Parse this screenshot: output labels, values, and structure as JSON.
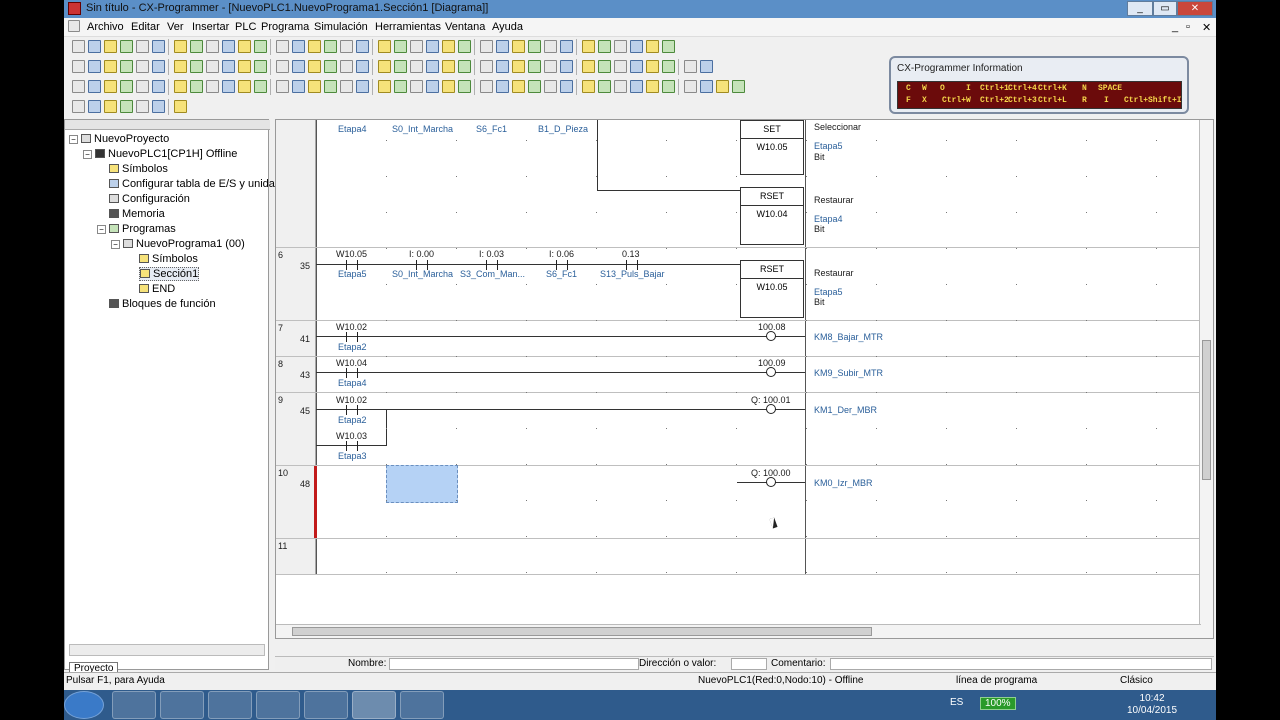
{
  "window": {
    "title": "Sin título - CX-Programmer - [NuevoPLC1.NuevoPrograma1.Sección1 [Diagrama]]"
  },
  "menu": [
    "Archivo",
    "Editar",
    "Ver",
    "Insertar",
    "PLC",
    "Programa",
    "Simulación",
    "Herramientas",
    "Ventana",
    "Ayuda"
  ],
  "info_panel": {
    "title": "CX-Programmer Information",
    "keys_top": [
      "C",
      "W",
      "O",
      "I",
      "Ctrl+1",
      "Ctrl+4",
      "Ctrl+K",
      "N",
      "SPACE"
    ],
    "keys_bottom": [
      "F",
      "X",
      "Ctrl+W",
      "Ctrl+2",
      "Ctrl+3",
      "Ctrl+L",
      "R",
      "I",
      "Ctrl+Shift+I"
    ]
  },
  "project_tree": {
    "root": "NuevoProyecto",
    "plc": "NuevoPLC1[CP1H] Offline",
    "items": [
      "Símbolos",
      "Configurar tabla de E/S y unida",
      "Configuración",
      "Memoria",
      "Programas"
    ],
    "program": "NuevoPrograma1 (00)",
    "program_items": [
      "Símbolos",
      "Sección1",
      "END"
    ],
    "function_blocks": "Bloques de función",
    "tab": "Proyecto"
  },
  "ladder": {
    "rung5_top": {
      "labels": [
        "Etapa4",
        "S0_Int_Marcha",
        "S6_Fc1",
        "B1_D_Pieza"
      ],
      "set_box": {
        "op": "SET",
        "operand": "W10.05"
      },
      "set_cmt": [
        "Seleccionar",
        "Etapa5",
        "Bit"
      ],
      "rset_box": {
        "op": "RSET",
        "operand": "W10.04"
      },
      "rset_cmt": [
        "Restaurar",
        "Etapa4",
        "Bit"
      ]
    },
    "rung6": {
      "num": "6",
      "step": "35",
      "addrs": [
        "W10.05",
        "I: 0.00",
        "I: 0.03",
        "I: 0.06",
        "0.13"
      ],
      "names": [
        "Etapa5",
        "S0_Int_Marcha",
        "S3_Com_Man...",
        "S6_Fc1",
        "S13_Puls_Bajar"
      ],
      "box": {
        "op": "RSET",
        "operand": "W10.05"
      },
      "cmt": [
        "Restaurar",
        "Etapa5",
        "Bit"
      ]
    },
    "rung7": {
      "num": "7",
      "step": "41",
      "addr": "W10.02",
      "name": "Etapa2",
      "out": "100.08",
      "out_name": "KM8_Bajar_MTR"
    },
    "rung8": {
      "num": "8",
      "step": "43",
      "addr": "W10.04",
      "name": "Etapa4",
      "out": "100.09",
      "out_name": "KM9_Subir_MTR"
    },
    "rung9": {
      "num": "9",
      "step": "45",
      "addr": "W10.02",
      "name": "Etapa2",
      "addr2": "W10.03",
      "name2": "Etapa3",
      "out": "Q: 100.01",
      "out_name": "KM1_Der_MBR"
    },
    "rung10": {
      "num": "10",
      "step": "48",
      "out": "Q: 100.00",
      "out_name": "KM0_Izr_MBR"
    },
    "rung11": {
      "num": "11"
    }
  },
  "infobar": {
    "name": "Nombre:",
    "address": "Dirección o valor:",
    "comment": "Comentario:"
  },
  "status": {
    "help": "Pulsar F1, para Ayuda",
    "plc": "NuevoPLC1(Red:0,Nodo:10) - Offline",
    "mode": "línea de programa",
    "view": "Clásico"
  },
  "taskbar": {
    "lang": "ES",
    "zoom": "100%",
    "time": "10:42",
    "date": "10/04/2015"
  }
}
